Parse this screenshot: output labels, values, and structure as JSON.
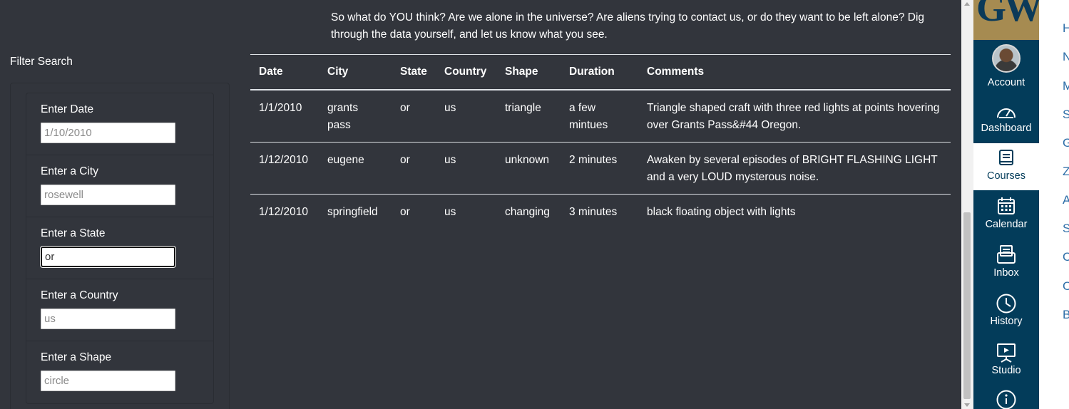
{
  "intro_text": "So what do YOU think? Are we alone in the universe? Are aliens trying to contact us, or do they want to be left alone? Dig through the data yourself, and let us know what you see.",
  "filters": {
    "title": "Filter Search",
    "items": [
      {
        "label": "Enter Date",
        "placeholder": "1/10/2010",
        "value": ""
      },
      {
        "label": "Enter a City",
        "placeholder": "rosewell",
        "value": ""
      },
      {
        "label": "Enter a State",
        "placeholder": "",
        "value": "or"
      },
      {
        "label": "Enter a Country",
        "placeholder": "us",
        "value": ""
      },
      {
        "label": "Enter a Shape",
        "placeholder": "circle",
        "value": ""
      }
    ]
  },
  "table": {
    "headers": [
      "Date",
      "City",
      "State",
      "Country",
      "Shape",
      "Duration",
      "Comments"
    ],
    "rows": [
      [
        "1/1/2010",
        "grants pass",
        "or",
        "us",
        "triangle",
        "a few mintues",
        "Triangle shaped craft with three red lights at points hovering over Grants Pass&#44 Oregon."
      ],
      [
        "1/12/2010",
        "eugene",
        "or",
        "us",
        "unknown",
        "2 minutes",
        "Awaken by several episodes of BRIGHT FLASHING LIGHT and a very LOUD mysterous noise."
      ],
      [
        "1/12/2010",
        "springfield",
        "or",
        "us",
        "changing",
        "3 minutes",
        "black floating object with lights"
      ]
    ]
  },
  "global_nav": {
    "logo": "GW",
    "items": [
      {
        "label": "Account",
        "icon": "avatar"
      },
      {
        "label": "Dashboard",
        "icon": "dashboard-icon"
      },
      {
        "label": "Courses",
        "icon": "courses-icon",
        "active": true
      },
      {
        "label": "Calendar",
        "icon": "calendar-icon"
      },
      {
        "label": "Inbox",
        "icon": "inbox-icon"
      },
      {
        "label": "History",
        "icon": "history-icon"
      },
      {
        "label": "Studio",
        "icon": "studio-icon"
      },
      {
        "label": "",
        "icon": "help-icon"
      }
    ]
  },
  "course_menu_letters": [
    "H",
    "N",
    "M",
    "S",
    "G",
    "Z",
    "A",
    "S",
    "C",
    "C",
    "B"
  ],
  "colors": {
    "page_bg": "#32353c",
    "nav_bg": "#033c5a",
    "logo_bg": "#a68b51",
    "link": "#2d6ea8"
  }
}
